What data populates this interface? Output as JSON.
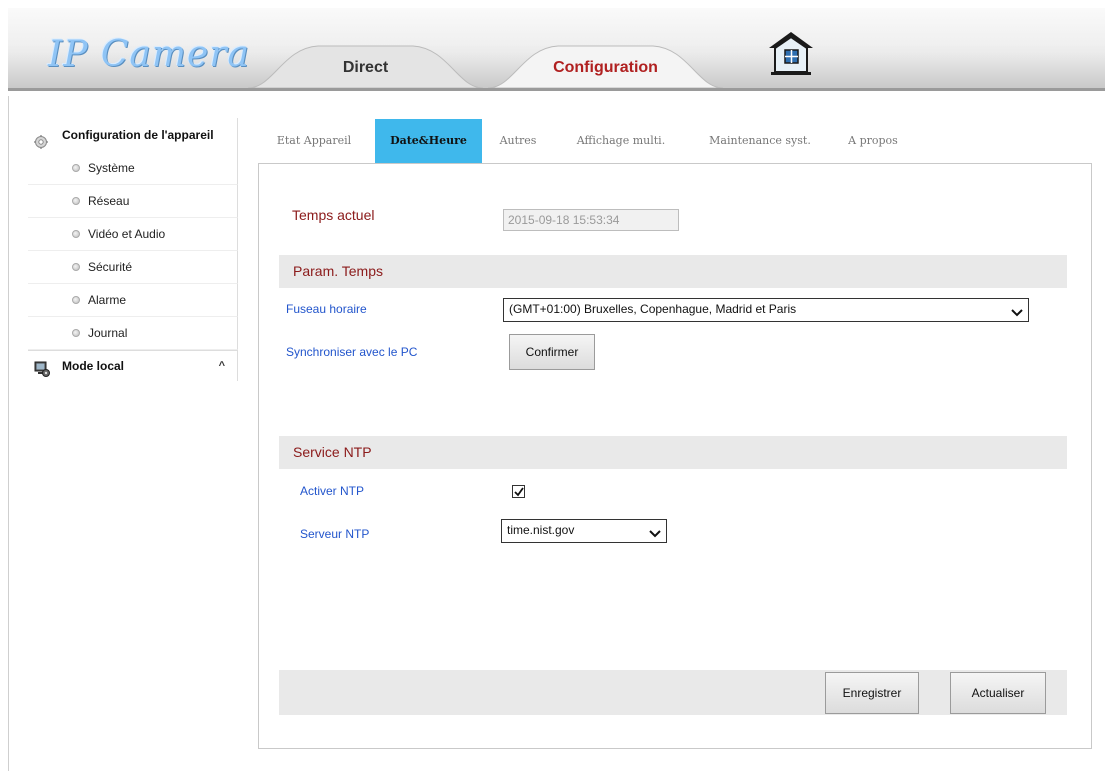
{
  "header": {
    "logo": "IP Camera",
    "tabs": [
      {
        "label": "Direct"
      },
      {
        "label": "Configuration"
      }
    ]
  },
  "sidebar": {
    "group_title": "Configuration de l'appareil",
    "items": [
      {
        "label": "Système"
      },
      {
        "label": "Réseau"
      },
      {
        "label": "Vidéo et Audio"
      },
      {
        "label": "Sécurité"
      },
      {
        "label": "Alarme"
      },
      {
        "label": "Journal"
      }
    ],
    "local_title": "Mode local",
    "local_caret": "^"
  },
  "content_tabs": [
    {
      "label": "Etat Appareil"
    },
    {
      "label": "Date&Heure"
    },
    {
      "label": "Autres"
    },
    {
      "label": "Affichage multi."
    },
    {
      "label": "Maintenance syst."
    },
    {
      "label": "A propos"
    }
  ],
  "form": {
    "current_time_label": "Temps actuel",
    "current_time_value": "2015-09-18 15:53:34",
    "section_time": "Param. Temps",
    "timezone_label": "Fuseau horaire",
    "timezone_value": "(GMT+01:00) Bruxelles, Copenhague, Madrid et Paris",
    "sync_label": "Synchroniser avec le PC",
    "confirm_button": "Confirmer",
    "section_ntp": "Service NTP",
    "ntp_enable_label": "Activer NTP",
    "ntp_enabled": true,
    "ntp_server_label": "Serveur NTP",
    "ntp_server_value": "time.nist.gov",
    "save_button": "Enregistrer",
    "refresh_button": "Actualiser"
  },
  "colors": {
    "active_tab": "#3fb8ec",
    "section_label": "#8b1a1a",
    "field_label": "#2255cc",
    "config_tab_text": "#b02020"
  }
}
